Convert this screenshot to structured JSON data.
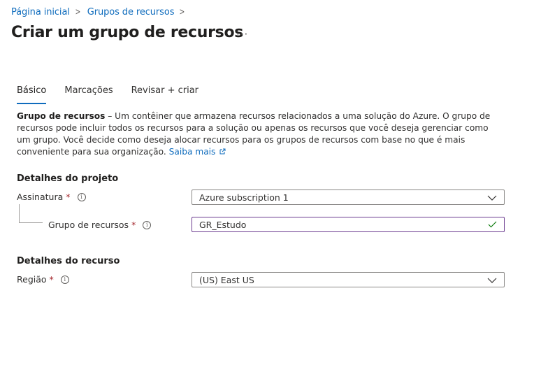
{
  "breadcrumb": {
    "items": [
      {
        "label": "Página inicial"
      },
      {
        "label": "Grupos de recursos"
      }
    ]
  },
  "page": {
    "title": "Criar um grupo de recursos",
    "more_label": "···"
  },
  "tabs": [
    {
      "label": "Básico",
      "active": true
    },
    {
      "label": "Marcações",
      "active": false
    },
    {
      "label": "Revisar + criar",
      "active": false
    }
  ],
  "description": {
    "term": "Grupo de recursos",
    "text": " – Um contêiner que armazena recursos relacionados a uma solução do Azure. O grupo de recursos pode incluir todos os recursos para a solução ou apenas os recursos que você deseja gerenciar como um grupo. Você decide como deseja alocar recursos para os grupos de recursos com base no que é mais conveniente para sua organização. ",
    "link": "Saiba mais"
  },
  "project": {
    "heading": "Detalhes do projeto",
    "subscription_label": "Assinatura",
    "subscription_value": "Azure subscription 1",
    "rg_label": "Grupo de recursos",
    "rg_value": "GR_Estudo",
    "rg_valid": true
  },
  "resource": {
    "heading": "Detalhes do recurso",
    "region_label": "Região",
    "region_value": "(US) East US"
  },
  "required_marker": "*",
  "colors": {
    "link": "#0f6cbd",
    "required": "#a4262c",
    "valid_check": "#107c10",
    "valid_border": "#6b3b8f"
  }
}
